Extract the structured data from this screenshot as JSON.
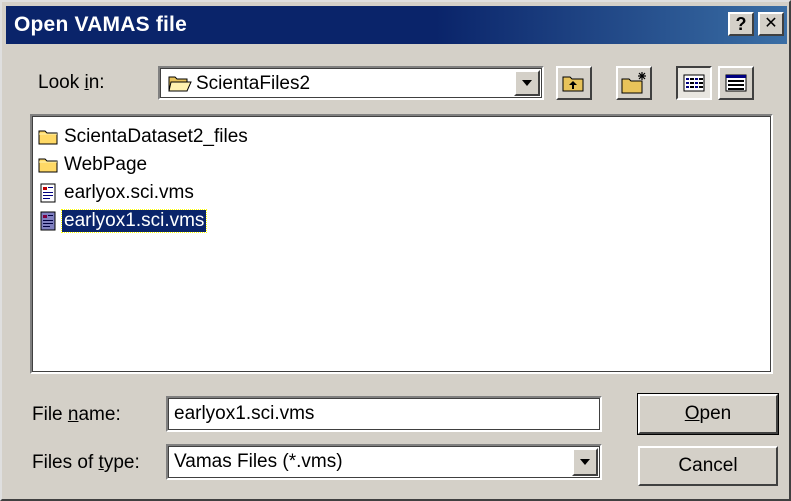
{
  "window": {
    "title": "Open VAMAS file",
    "help_button": "?",
    "close_button": "✕"
  },
  "look_in": {
    "label_prefix": "Look ",
    "label_mnemonic": "i",
    "label_suffix": "n:",
    "value": "ScientaFiles2"
  },
  "toolbar": {
    "up_folder_icon": "up-one-level-icon",
    "new_folder_icon": "create-new-folder-icon",
    "list_view_icon": "list-view-icon",
    "details_view_icon": "details-view-icon"
  },
  "files": [
    {
      "name": "ScientaDataset2_files",
      "type": "folder",
      "selected": false
    },
    {
      "name": "WebPage",
      "type": "folder",
      "selected": false
    },
    {
      "name": "earlyox.sci.vms",
      "type": "file",
      "selected": false
    },
    {
      "name": "earlyox1.sci.vms",
      "type": "file",
      "selected": true
    }
  ],
  "file_name": {
    "label_prefix": "File ",
    "label_mnemonic": "n",
    "label_suffix": "ame:",
    "value": "earlyox1.sci.vms"
  },
  "file_type": {
    "label_prefix": "Files of ",
    "label_mnemonic": "t",
    "label_suffix": "ype:",
    "value": "Vamas Files (*.vms)"
  },
  "buttons": {
    "open_mnemonic": "O",
    "open_rest": "pen",
    "cancel": "Cancel"
  },
  "colors": {
    "title_bar": "#0a246a",
    "dialog_face": "#d4d0c8",
    "selection": "#0a246a",
    "folder": "#ffd966"
  }
}
